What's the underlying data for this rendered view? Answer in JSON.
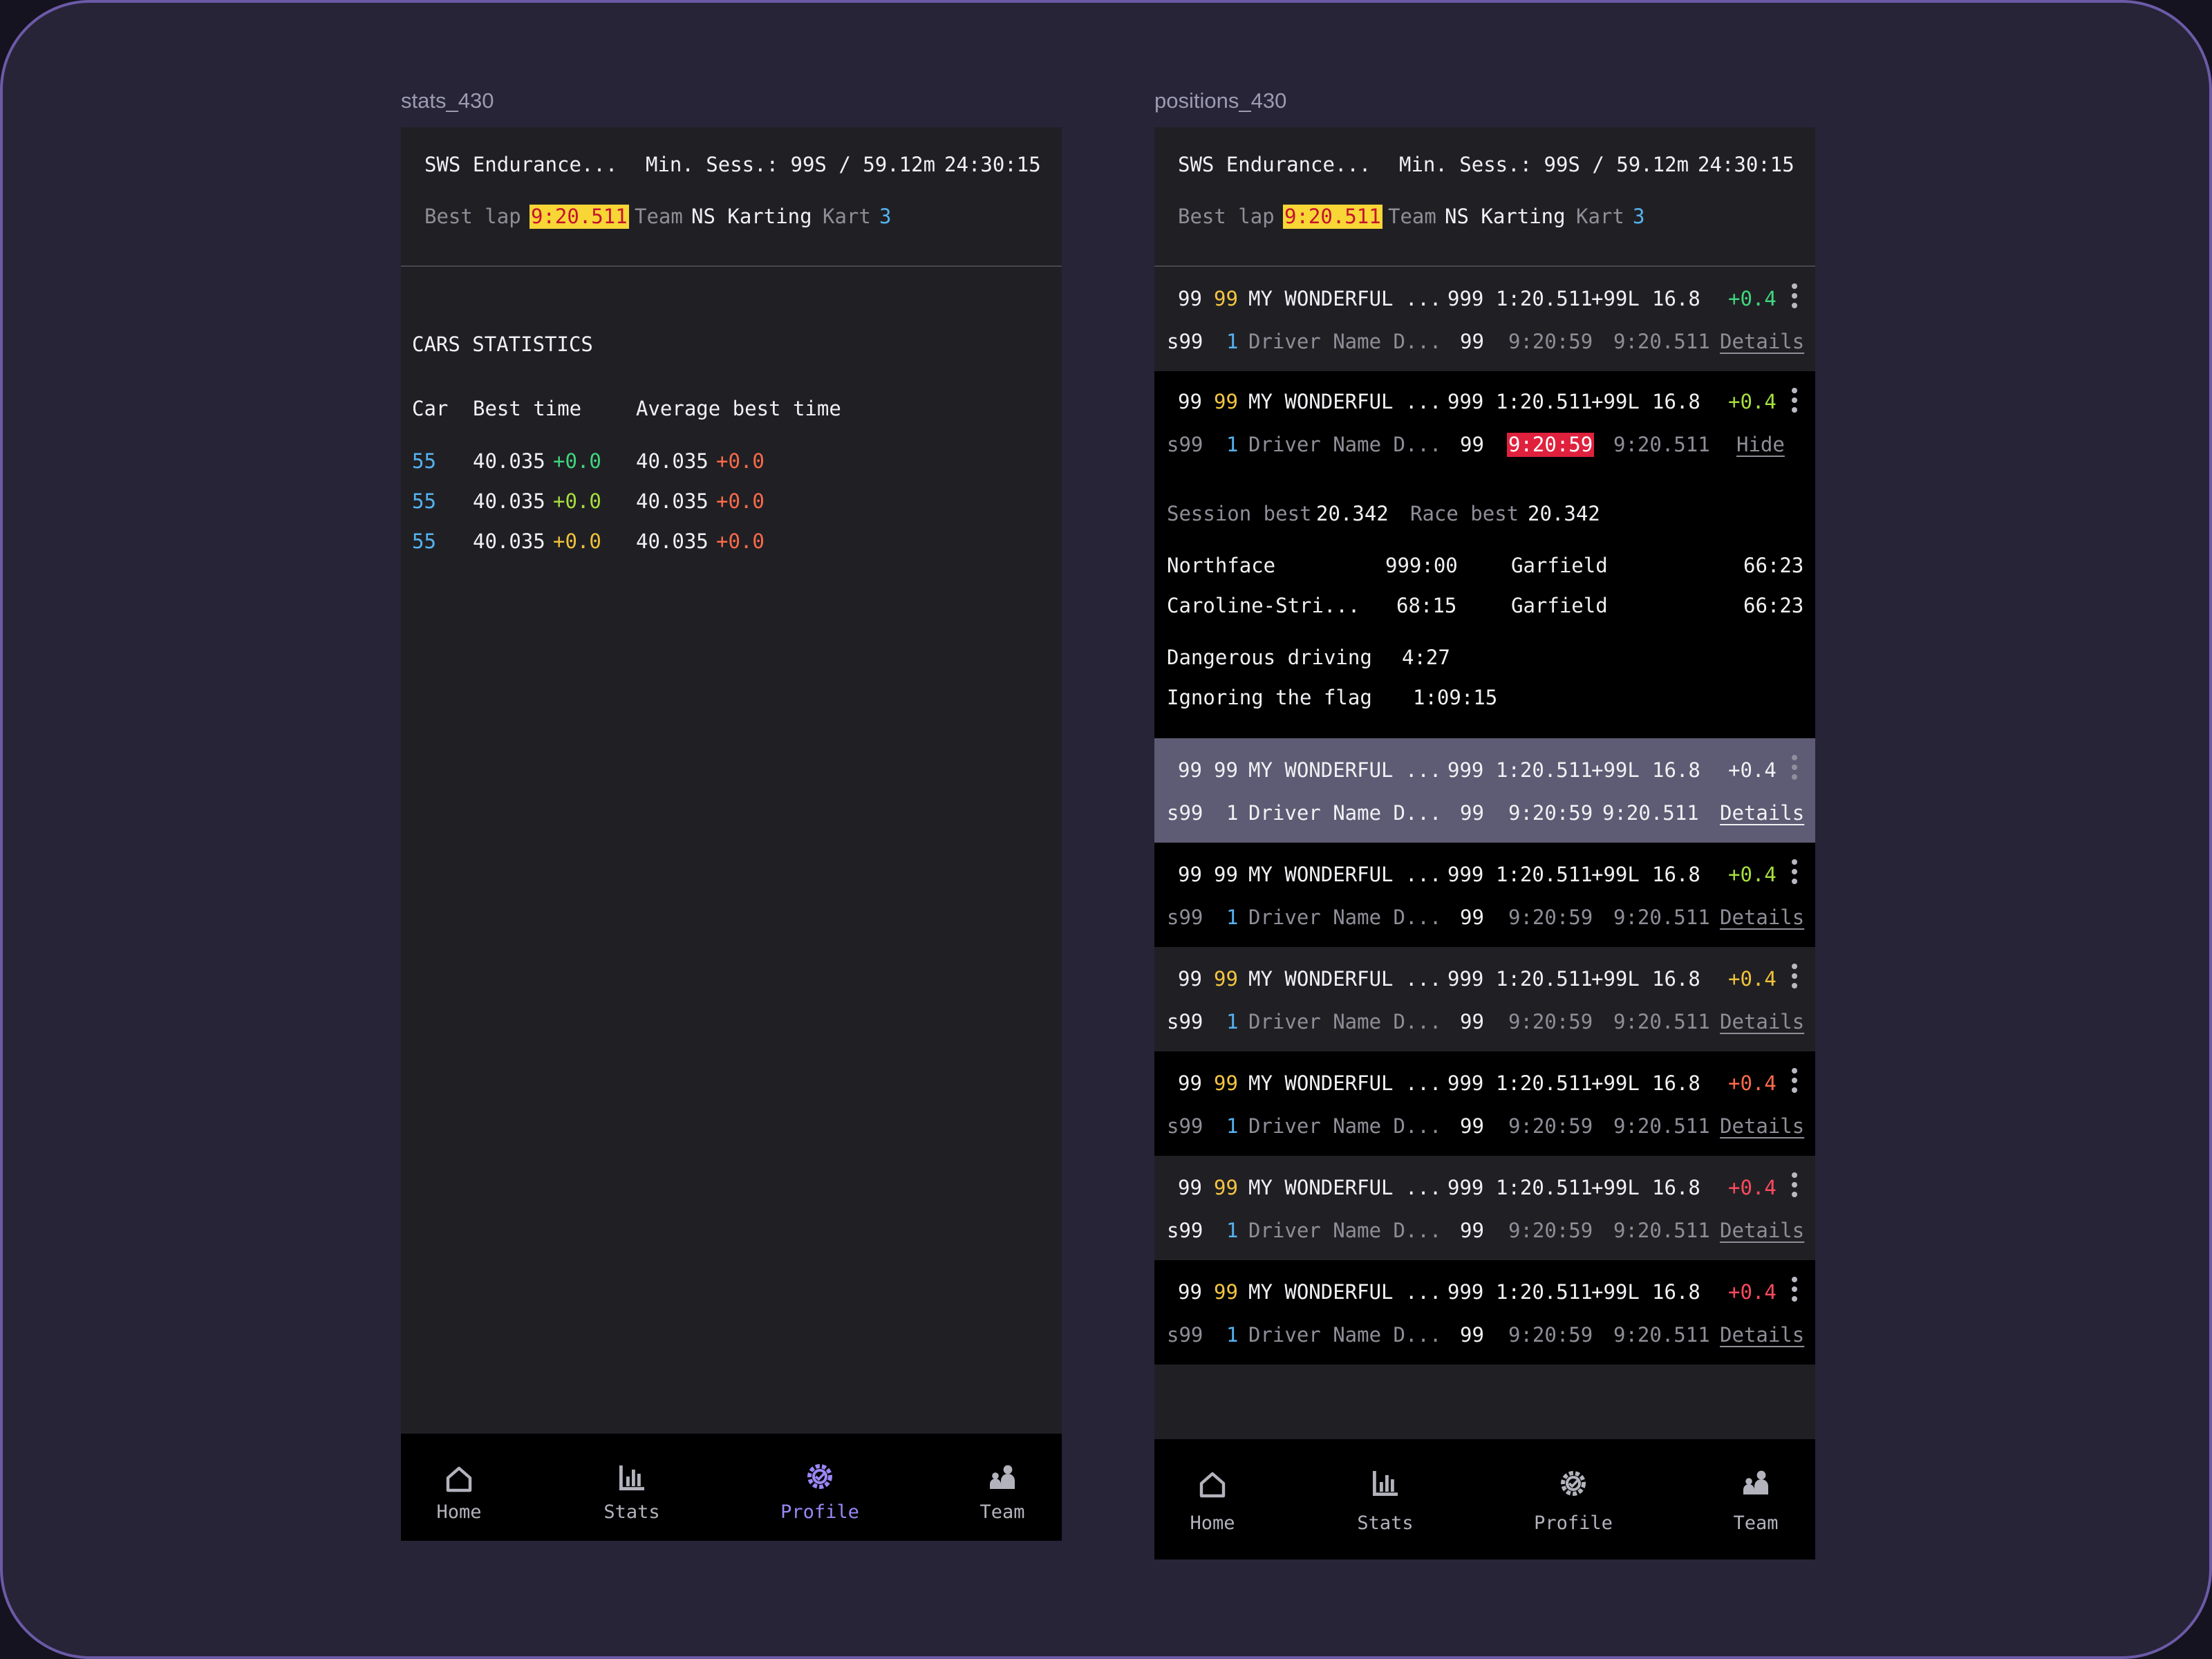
{
  "stats_screen": {
    "frame_label": "stats_430",
    "header": {
      "event": "SWS Endurance...",
      "min_session": "Min. Sess.: 99S / 59.12m",
      "clock": "24:30:15",
      "best_lap_label": "Best lap",
      "best_lap": "9:20.511",
      "team_label": "Team",
      "team": "NS Karting",
      "kart_label": "Kart",
      "kart": "3"
    },
    "section_title": "CARS STATISTICS",
    "columns": [
      "Car",
      "Best time",
      "Average best time"
    ],
    "rows": [
      {
        "car": "55",
        "best": "40.035",
        "best_delta": "+0.0",
        "avg": "40.035",
        "avg_delta": "+0.0"
      },
      {
        "car": "55",
        "best": "40.035",
        "best_delta": "+0.0",
        "avg": "40.035",
        "avg_delta": "+0.0"
      },
      {
        "car": "55",
        "best": "40.035",
        "best_delta": "+0.0",
        "avg": "40.035",
        "avg_delta": "+0.0"
      }
    ],
    "tabs": [
      {
        "label": "Home",
        "icon": "home-icon"
      },
      {
        "label": "Stats",
        "icon": "bar-chart-icon"
      },
      {
        "label": "Profile",
        "icon": "gear-icon",
        "active": true
      },
      {
        "label": "Team",
        "icon": "team-icon"
      }
    ]
  },
  "positions_screen": {
    "frame_label": "positions_430",
    "header": {
      "event": "SWS Endurance...",
      "min_session": "Min. Sess.: 99S / 59.12m",
      "clock": "24:30:15",
      "best_lap_label": "Best lap",
      "best_lap": "9:20.511",
      "team_label": "Team",
      "team": "NS Karting",
      "kart_label": "Kart",
      "kart": "3"
    },
    "rows": [
      {
        "pos": "99",
        "kart": "99",
        "name": "MY WONDERFUL ...",
        "laps": "999",
        "last_lap": "1:20.511",
        "gap": "+99L",
        "speed": "16.8",
        "delta": "+0.4",
        "stint": "s99",
        "driver_no": "1",
        "driver": "Driver Name D...",
        "driver_laps": "99",
        "stint_time": "9:20:59",
        "best": "9:20.511",
        "action": "Details"
      },
      {
        "pos": "99",
        "kart": "99",
        "name": "MY WONDERFUL ...",
        "laps": "999",
        "last_lap": "1:20.511",
        "gap": "+99L",
        "speed": "16.8",
        "delta": "+0.4",
        "stint": "s99",
        "driver_no": "1",
        "driver": "Driver Name D...",
        "driver_laps": "99",
        "stint_time": "9:20:59",
        "best": "9:20.511",
        "action": "Hide"
      },
      {
        "pos": "99",
        "kart": "99",
        "name": "MY WONDERFUL ...",
        "laps": "999",
        "last_lap": "1:20.511",
        "gap": "+99L",
        "speed": "16.8",
        "delta": "+0.4",
        "stint": "s99",
        "driver_no": "1",
        "driver": "Driver Name D...",
        "driver_laps": "99",
        "stint_time": "9:20:59",
        "best": "9:20.511",
        "action": "Details"
      },
      {
        "pos": "99",
        "kart": "99",
        "name": "MY WONDERFUL ...",
        "laps": "999",
        "last_lap": "1:20.511",
        "gap": "+99L",
        "speed": "16.8",
        "delta": "+0.4",
        "stint": "s99",
        "driver_no": "1",
        "driver": "Driver Name D...",
        "driver_laps": "99",
        "stint_time": "9:20:59",
        "best": "9:20.511",
        "action": "Details"
      },
      {
        "pos": "99",
        "kart": "99",
        "name": "MY WONDERFUL ...",
        "laps": "999",
        "last_lap": "1:20.511",
        "gap": "+99L",
        "speed": "16.8",
        "delta": "+0.4",
        "stint": "s99",
        "driver_no": "1",
        "driver": "Driver Name D...",
        "driver_laps": "99",
        "stint_time": "9:20:59",
        "best": "9:20.511",
        "action": "Details"
      },
      {
        "pos": "99",
        "kart": "99",
        "name": "MY WONDERFUL ...",
        "laps": "999",
        "last_lap": "1:20.511",
        "gap": "+99L",
        "speed": "16.8",
        "delta": "+0.4",
        "stint": "s99",
        "driver_no": "1",
        "driver": "Driver Name D...",
        "driver_laps": "99",
        "stint_time": "9:20:59",
        "best": "9:20.511",
        "action": "Details"
      },
      {
        "pos": "99",
        "kart": "99",
        "name": "MY WONDERFUL ...",
        "laps": "999",
        "last_lap": "1:20.511",
        "gap": "+99L",
        "speed": "16.8",
        "delta": "+0.4",
        "stint": "s99",
        "driver_no": "1",
        "driver": "Driver Name D...",
        "driver_laps": "99",
        "stint_time": "9:20:59",
        "best": "9:20.511",
        "action": "Details"
      },
      {
        "pos": "99",
        "kart": "99",
        "name": "MY WONDERFUL ...",
        "laps": "999",
        "last_lap": "1:20.511",
        "gap": "+99L",
        "speed": "16.8",
        "delta": "+0.4",
        "stint": "s99",
        "driver_no": "1",
        "driver": "Driver Name D...",
        "driver_laps": "99",
        "stint_time": "9:20:59",
        "best": "9:20.511",
        "action": "Details"
      }
    ],
    "details": {
      "session_best_label": "Session best",
      "session_best": "20.342",
      "race_best_label": "Race best",
      "race_best": "20.342",
      "sectors": [
        {
          "a_name": "Northface",
          "a_time": "999:00",
          "b_name": "Garfield",
          "b_time": "66:23"
        },
        {
          "a_name": "Caroline-Stri...",
          "a_time": "68:15",
          "b_name": "Garfield",
          "b_time": "66:23"
        }
      ],
      "penalties": [
        {
          "label": "Dangerous driving",
          "time": "4:27"
        },
        {
          "label": "Ignoring the flag",
          "time": "1:09:15"
        }
      ]
    },
    "tabs": [
      {
        "label": "Home",
        "icon": "home-icon"
      },
      {
        "label": "Stats",
        "icon": "bar-chart-icon"
      },
      {
        "label": "Profile",
        "icon": "gear-icon"
      },
      {
        "label": "Team",
        "icon": "team-icon"
      }
    ]
  }
}
